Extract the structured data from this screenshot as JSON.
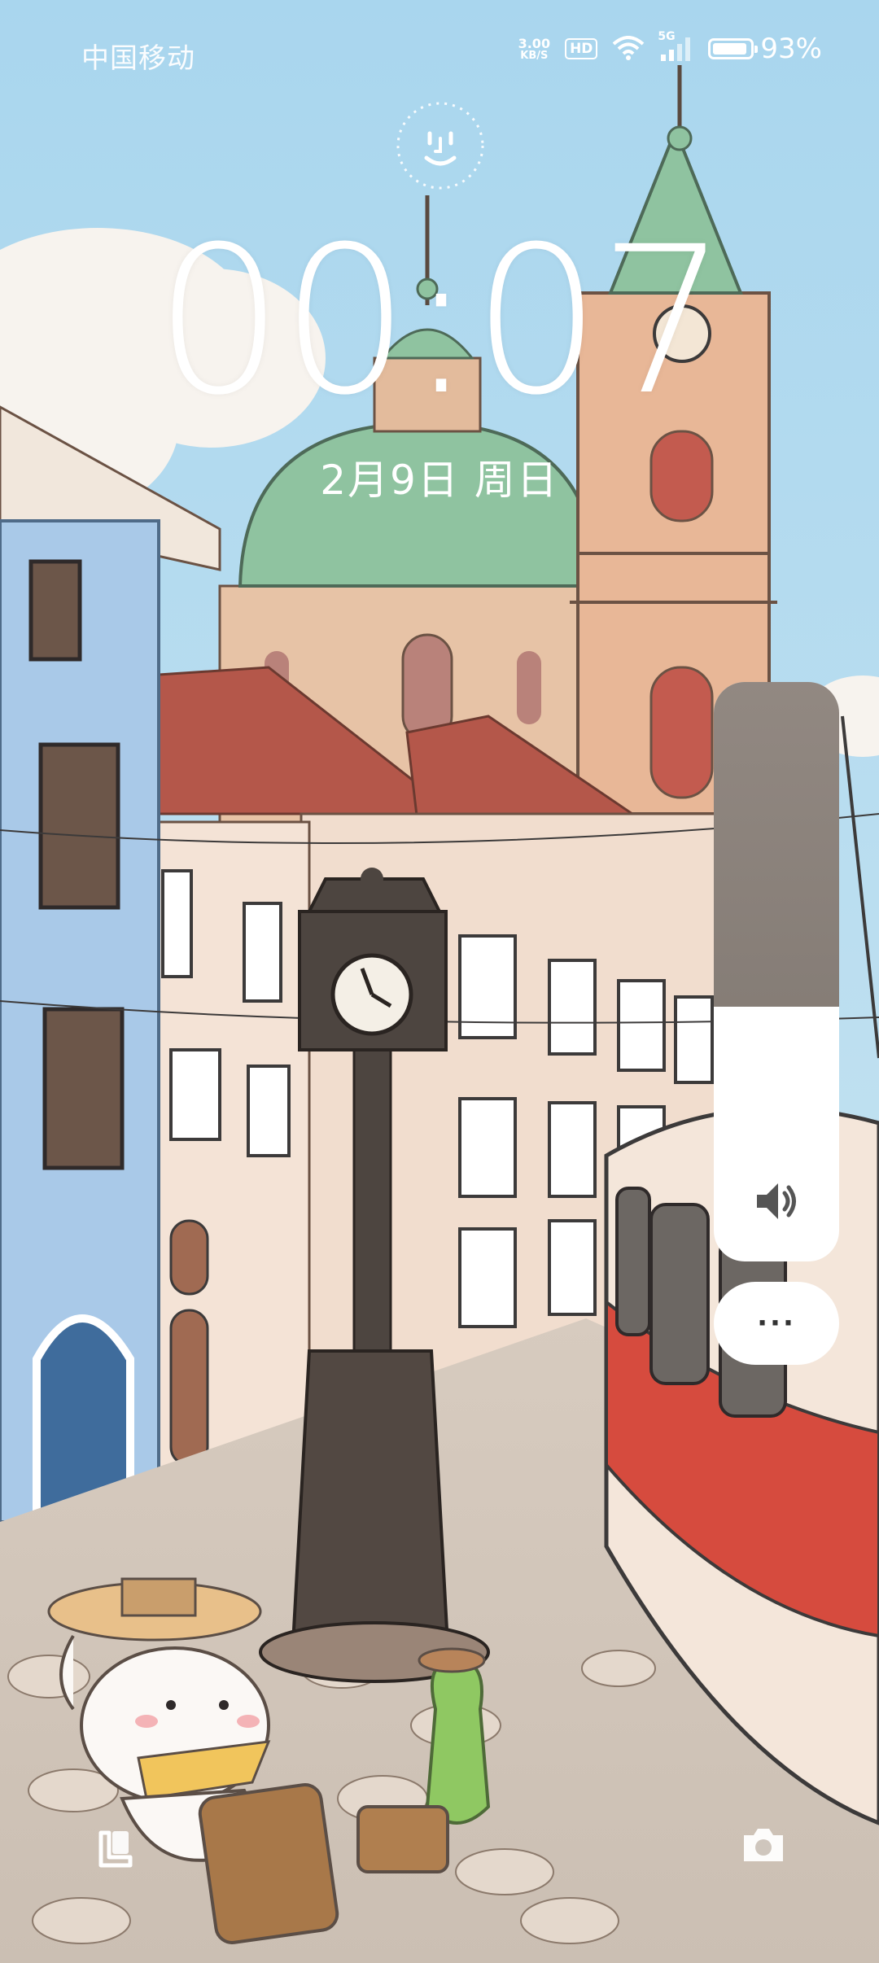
{
  "status_bar": {
    "carrier": "中国移动",
    "net_speed": "3.00",
    "net_unit": "KB/S",
    "hd_label": "HD",
    "signal_label": "5G",
    "battery_percent": "93%",
    "battery_level": 0.93
  },
  "lock_screen": {
    "time": "00:07",
    "date": "2月9日 周日"
  },
  "volume": {
    "level": 0.44
  },
  "icons": {
    "face": "face-unlock-icon",
    "volume": "speaker-icon",
    "more": "more-icon",
    "left_shortcut": "smart-card-icon",
    "right_shortcut": "camera-icon"
  },
  "more_button_label": "···"
}
